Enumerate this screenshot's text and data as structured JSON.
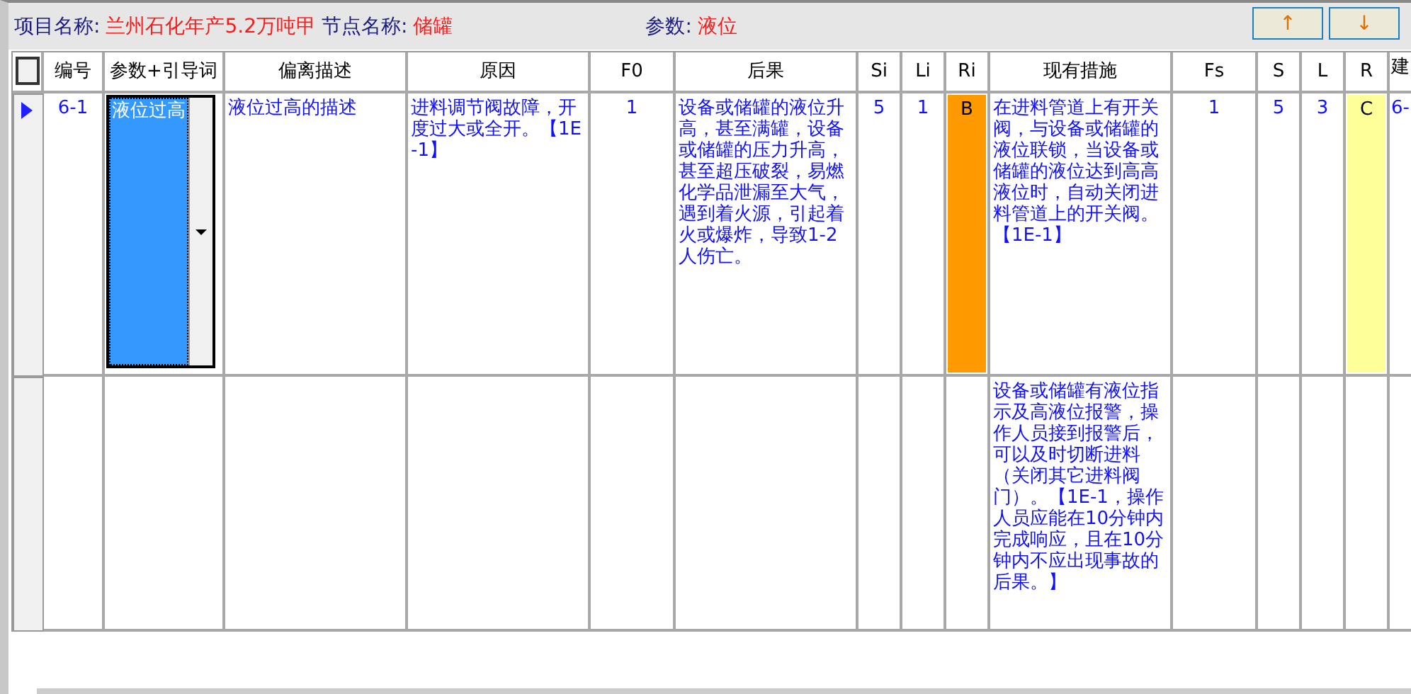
{
  "header": {
    "project_label": "项目名称:",
    "project_value": "兰州石化年产5.2万吨甲",
    "node_label": "节点名称:",
    "node_value": "储罐",
    "param_label": "参数:",
    "param_value": "液位"
  },
  "nav_buttons": [
    "↑",
    "↓"
  ],
  "table": {
    "columns": [
      "编号",
      "参数+引导词",
      "偏离描述",
      "原因",
      "F0",
      "后果",
      "Si",
      "Li",
      "Ri",
      "现有措施",
      "Fs",
      "S",
      "L",
      "R",
      "建"
    ],
    "rows": [
      {
        "current": true,
        "id": "6-1",
        "param_guide": "液位过高",
        "deviation": "液位过高的描述",
        "cause": "进料调节阀故障，开度过大或全开。【1E-1】",
        "f0": "1",
        "consequence": "设备或储罐的液位升高，甚至满罐，设备或储罐的压力升高，甚至超压破裂，易燃化学品泄漏至大气，遇到着火源，引起着火或爆炸，导致1-2人伤亡。",
        "si": "5",
        "li": "1",
        "ri": {
          "text": "B",
          "color": "#ff9900"
        },
        "measures": [
          {
            "text": "在进料管道上有开关阀，与设备或储罐的液位联锁，当设备或储罐的液位达到高高液位时，自动关闭进料管道上的开关阀。【1E-1】",
            "fs": "1",
            "s": "5",
            "l": "3",
            "r": {
              "text": "C",
              "color": "#ffff99"
            },
            "suggestion": "6-"
          },
          {
            "text": "设备或储罐有液位指示及高液位报警，操作人员接到报警后，可以及时切断进料（关闭其它进料阀门）。【1E-1，操作人员应能在10分钟内完成响应，且在10分钟内不应出现事故的后果。】"
          }
        ]
      }
    ]
  }
}
